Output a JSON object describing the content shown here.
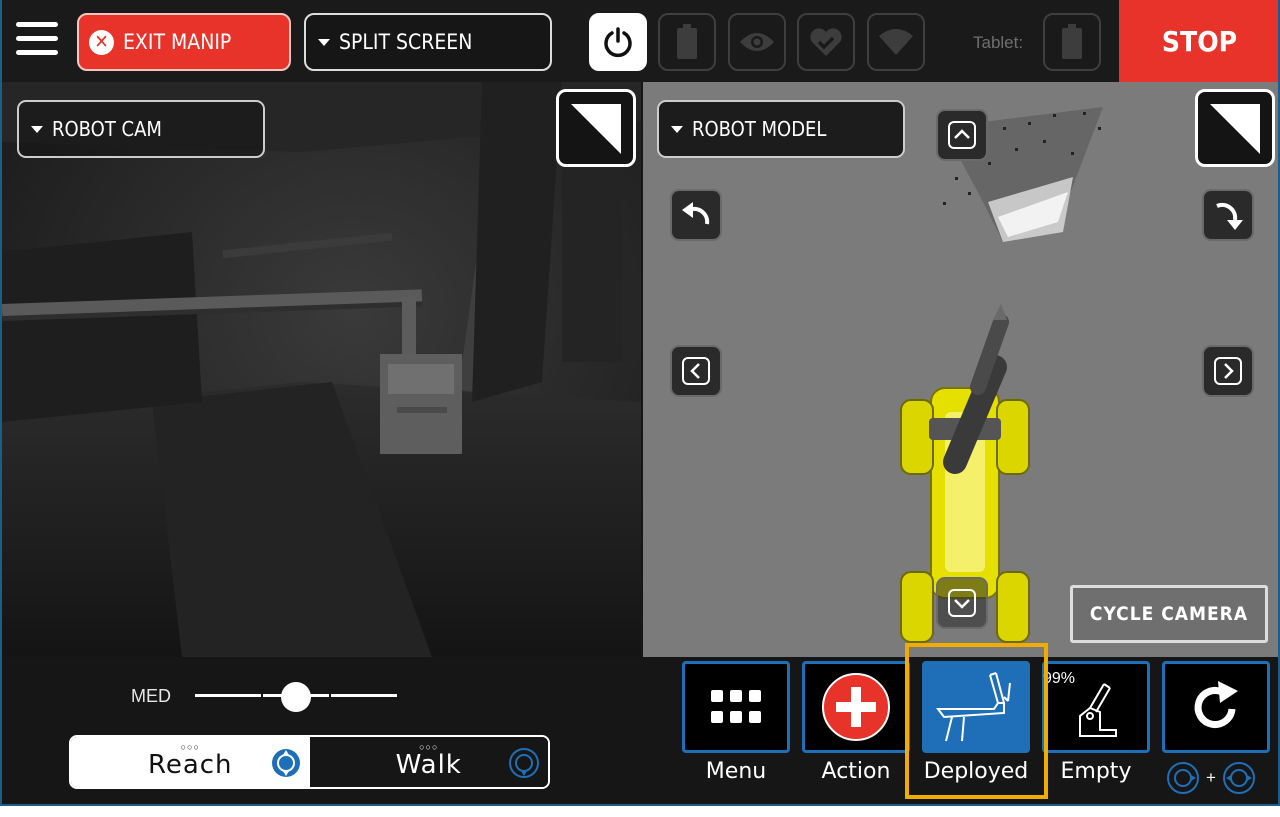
{
  "topbar": {
    "exit_label": "EXIT MANIP",
    "layout_label": "SPLIT SCREEN",
    "tablet_label": "Tablet:",
    "stop_label": "STOP"
  },
  "left_pane": {
    "camera_select": "ROBOT CAM"
  },
  "right_pane": {
    "view_select": "ROBOT MODEL",
    "cycle_camera_label": "CYCLE CAMERA"
  },
  "bottom": {
    "speed_label": "MED",
    "speed_level": 0.5,
    "mode_reach": "Reach",
    "mode_walk": "Walk",
    "mode_dots": "○○○",
    "battery_percent": "99%",
    "combo_plus": "+",
    "tiles": [
      {
        "label": "Menu"
      },
      {
        "label": "Action"
      },
      {
        "label": "Deployed"
      },
      {
        "label": "Empty"
      }
    ]
  },
  "colors": {
    "accent": "#1f6fb8",
    "stop": "#e8332a",
    "highlight": "#f0ad00",
    "robot_body": "#e5e000"
  }
}
